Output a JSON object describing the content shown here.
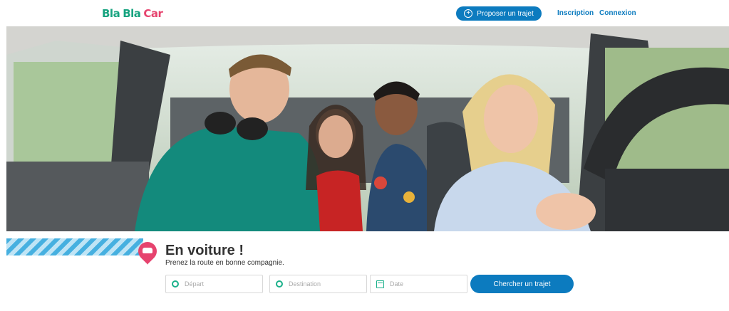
{
  "brand": {
    "word1": "Bla",
    "word2": "Bla",
    "word3": "Car"
  },
  "header": {
    "offer_label": "Proposer un trajet",
    "inscription_label": "Inscription",
    "connexion_label": "Connexion"
  },
  "hero": {
    "title": "En voiture !",
    "subtitle": "Prenez la route en bonne compagnie."
  },
  "search": {
    "departure_placeholder": "Départ",
    "destination_placeholder": "Destination",
    "date_placeholder": "Date",
    "submit_label": "Chercher un trajet"
  },
  "colors": {
    "brand_green": "#16a37f",
    "brand_pink": "#e6436e",
    "primary_blue": "#0c7bbf"
  },
  "icons": [
    "plus-circle-icon",
    "map-pin-icon",
    "origin-ring-icon",
    "destination-ring-icon",
    "calendar-icon"
  ]
}
